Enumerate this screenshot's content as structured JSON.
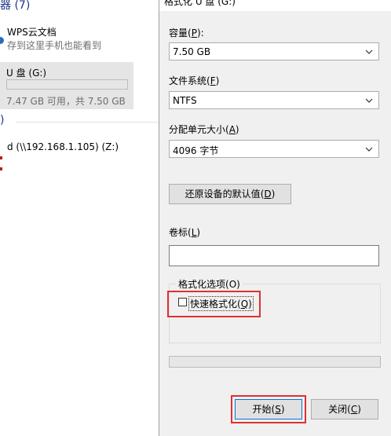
{
  "explorer": {
    "devices_header": "器 (7)",
    "wps": {
      "title": "WPS云文档",
      "subtitle": "存到这里手机也能看到"
    },
    "drive": {
      "title": "U 盘 (G:)",
      "usage": "7.47 GB 可用，共 7.50 GB",
      "used_fraction": 0.004
    },
    "network_header": ")",
    "network_drive": "d (\\\\192.168.1.105) (Z:)"
  },
  "dialog": {
    "title": "格式化 U 盘 (G:)",
    "capacity": {
      "label": "容量",
      "hotkey": "P",
      "value": "7.50 GB"
    },
    "filesystem": {
      "label": "文件系统",
      "hotkey": "F",
      "value": "NTFS"
    },
    "allocation": {
      "label": "分配单元大小",
      "hotkey": "A",
      "value": "4096 字节"
    },
    "restore_defaults": {
      "label": "还原设备的默认值",
      "hotkey": "D"
    },
    "volume_label": {
      "label": "卷标",
      "hotkey": "L",
      "value": ""
    },
    "options": {
      "legend": "格式化选项",
      "legend_hotkey": "O",
      "quick_format": {
        "label": "快速格式化",
        "hotkey": "Q",
        "checked": false
      }
    },
    "progress_fraction": 0,
    "start_button": {
      "label": "开始",
      "hotkey": "S"
    },
    "close_button": {
      "label": "关闭",
      "hotkey": "C"
    }
  },
  "colors": {
    "highlight": "#e03030",
    "accent": "#1e3287"
  }
}
